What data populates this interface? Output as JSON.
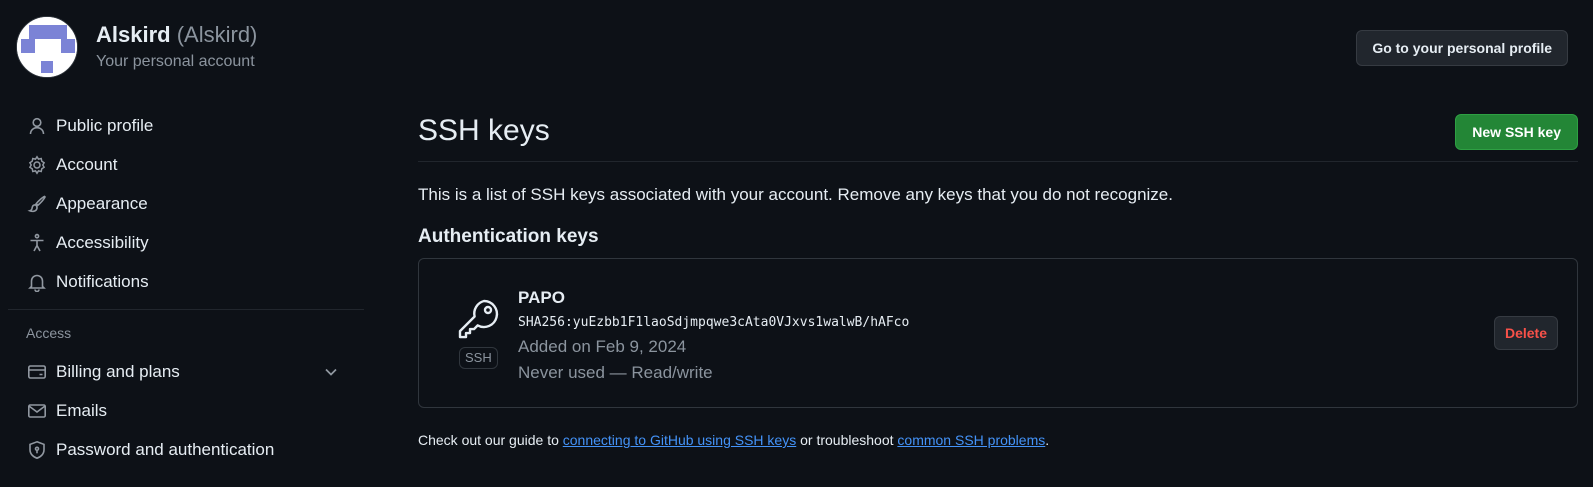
{
  "header": {
    "name": "Alskird",
    "login": "(Alskird)",
    "subtitle": "Your personal account",
    "profile_button": "Go to your personal profile"
  },
  "sidebar": {
    "items": [
      {
        "label": "Public profile",
        "icon": "person-icon"
      },
      {
        "label": "Account",
        "icon": "gear-icon"
      },
      {
        "label": "Appearance",
        "icon": "paintbrush-icon"
      },
      {
        "label": "Accessibility",
        "icon": "accessibility-icon"
      },
      {
        "label": "Notifications",
        "icon": "bell-icon"
      }
    ],
    "access_heading": "Access",
    "access_items": [
      {
        "label": "Billing and plans",
        "icon": "credit-card-icon",
        "expandable": true
      },
      {
        "label": "Emails",
        "icon": "mail-icon"
      },
      {
        "label": "Password and authentication",
        "icon": "shield-icon"
      }
    ]
  },
  "main": {
    "title": "SSH keys",
    "new_key_button": "New SSH key",
    "intro": "This is a list of SSH keys associated with your account. Remove any keys that you do not recognize.",
    "auth_heading": "Authentication keys",
    "keys": [
      {
        "name": "PAPO",
        "fingerprint": "SHA256:yuEzbb1F1laoSdjmpqwe3cAta0VJxvs1walwB/hAFco",
        "added": "Added on Feb 9, 2024",
        "usage": "Never used — Read/write",
        "type_label": "SSH",
        "delete_label": "Delete"
      }
    ],
    "footer": {
      "prefix": "Check out our guide to ",
      "link1": "connecting to GitHub using SSH keys",
      "middle": " or troubleshoot ",
      "link2": "common SSH problems",
      "suffix": "."
    }
  },
  "colors": {
    "background": "#0d1117",
    "accent_link": "#4493f8",
    "primary_button": "#238636",
    "danger": "#f85149",
    "avatar_color": "#7b83d6"
  }
}
